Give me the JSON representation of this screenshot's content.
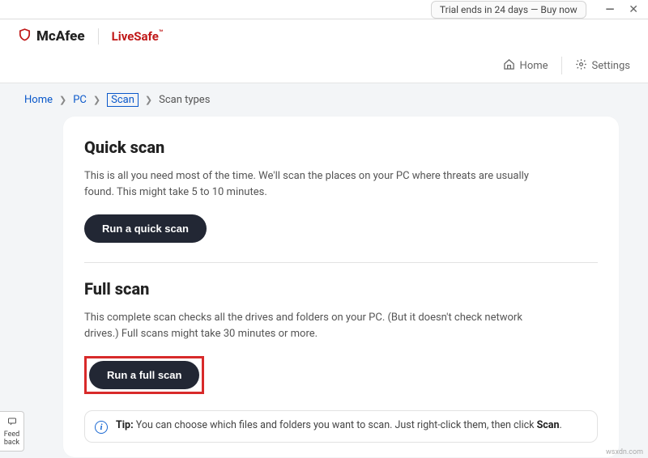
{
  "titlebar": {
    "trial_text": "Trial ends in 24 days — Buy now"
  },
  "brand": {
    "name": "McAfee",
    "product": "LiveSafe",
    "tm": "™"
  },
  "nav": {
    "home": "Home",
    "settings": "Settings"
  },
  "breadcrumb": {
    "home": "Home",
    "pc": "PC",
    "scan": "Scan",
    "scan_types": "Scan types"
  },
  "quick_scan": {
    "title": "Quick scan",
    "desc": "This is all you need most of the time. We'll scan the places on your PC where threats are usually found. This might take 5 to 10 minutes.",
    "button": "Run a quick scan"
  },
  "full_scan": {
    "title": "Full scan",
    "desc": "This complete scan checks all the drives and folders on your PC. (But it doesn't check network drives.) Full scans might take 30 minutes or more.",
    "button": "Run a full scan"
  },
  "tip": {
    "label": "Tip:",
    "text_before": " You can choose which files and folders you want to scan. Just right-click them, then click ",
    "bold_word": "Scan",
    "text_after": "."
  },
  "feedback": {
    "label": "Feed\nback"
  },
  "watermark": "wsxdn.com"
}
